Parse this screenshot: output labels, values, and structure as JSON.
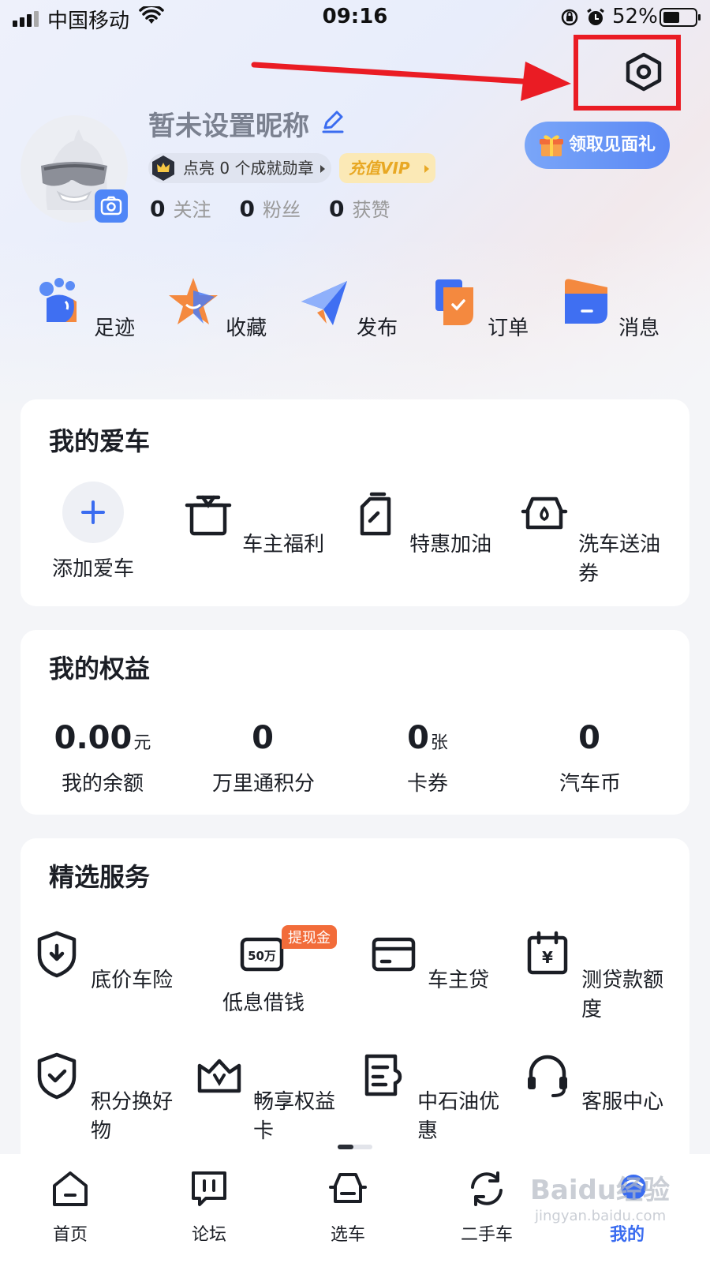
{
  "status_bar": {
    "carrier": "中国移动",
    "time": "09:16",
    "battery": "52%",
    "battery_level": 0.52
  },
  "profile": {
    "nickname": "暂未设置昵称",
    "badge_text": "点亮 0 个成就勋章",
    "vip_text": "充值VIP",
    "stats": [
      {
        "value": "0",
        "label": "关注"
      },
      {
        "value": "0",
        "label": "粉丝"
      },
      {
        "value": "0",
        "label": "获赞"
      }
    ],
    "gift_label": "领取见面礼"
  },
  "quick_actions": [
    {
      "label": "足迹",
      "icon": "footprint-icon"
    },
    {
      "label": "收藏",
      "icon": "star-icon"
    },
    {
      "label": "发布",
      "icon": "paper-plane-icon"
    },
    {
      "label": "订单",
      "icon": "order-icon"
    },
    {
      "label": "消息",
      "icon": "message-icon"
    }
  ],
  "my_car": {
    "title": "我的爱车",
    "items": [
      {
        "label": "添加爱车",
        "icon": "plus-icon"
      },
      {
        "label": "车主福利",
        "icon": "gift-box-icon"
      },
      {
        "label": "特惠加油",
        "icon": "fuel-can-icon"
      },
      {
        "label": "洗车送油券",
        "icon": "car-wash-icon"
      }
    ]
  },
  "benefits": {
    "title": "我的权益",
    "items": [
      {
        "value": "0.00",
        "unit": "元",
        "label": "我的余额"
      },
      {
        "value": "0",
        "unit": "",
        "label": "万里通积分"
      },
      {
        "value": "0",
        "unit": "张",
        "label": "卡券"
      },
      {
        "value": "0",
        "unit": "",
        "label": "汽车币"
      }
    ]
  },
  "services": {
    "title": "精选服务",
    "items": [
      {
        "label": "底价车险",
        "icon": "shield-download-icon"
      },
      {
        "label": "低息借钱",
        "icon": "loan-50w-icon",
        "badge": "提现金",
        "icon_text": "50万"
      },
      {
        "label": "车主贷",
        "icon": "card-icon"
      },
      {
        "label": "测贷款额度",
        "icon": "calendar-yen-icon",
        "icon_text": "¥"
      },
      {
        "label": "积分换好物",
        "icon": "shield-check-icon"
      },
      {
        "label": "畅享权益卡",
        "icon": "crown-v-icon"
      },
      {
        "label": "中石油优惠",
        "icon": "receipt-icon"
      },
      {
        "label": "客服中心",
        "icon": "headset-icon"
      }
    ]
  },
  "bottom_nav": {
    "items": [
      {
        "label": "首页",
        "icon": "home-icon"
      },
      {
        "label": "论坛",
        "icon": "forum-icon"
      },
      {
        "label": "选车",
        "icon": "car-select-icon"
      },
      {
        "label": "二手车",
        "icon": "used-car-icon"
      },
      {
        "label": "我的",
        "icon": "profile-icon",
        "active": true
      }
    ]
  },
  "watermark": {
    "text": "Baidu经验",
    "sub": "jingyan.baidu.com"
  },
  "colors": {
    "accent": "#3a6cf0",
    "annotation": "#ea1c24",
    "vip": "#e8a824",
    "tag": "#f26c3a"
  }
}
